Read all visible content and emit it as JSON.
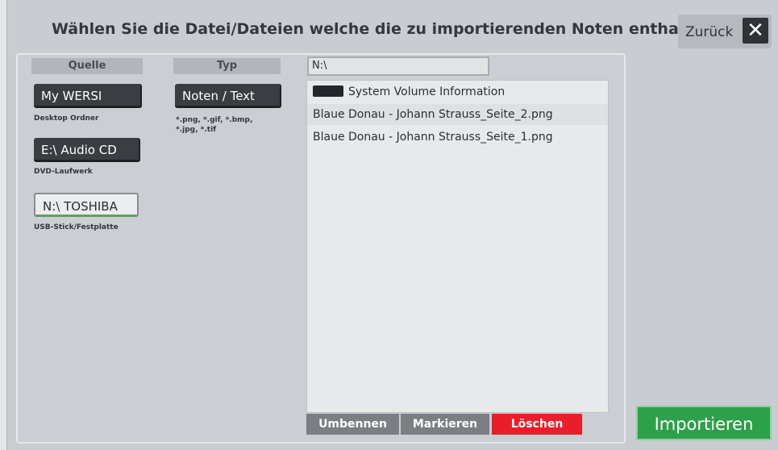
{
  "dialog": {
    "title": "Wählen Sie die Datei/Dateien welche die zu importierenden Noten enthalten.",
    "back_label": "Zurück",
    "close_glyph": "✕"
  },
  "source": {
    "header": "Quelle",
    "items": [
      {
        "label": "My WERSI",
        "sub": "Desktop Ordner"
      },
      {
        "label": "E:\\ Audio CD",
        "sub": "DVD-Laufwerk"
      },
      {
        "label": "N:\\ TOSHIBA",
        "sub": "USB-Stick/Festplatte"
      }
    ]
  },
  "type": {
    "header": "Typ",
    "button_label": "Noten / Text",
    "formats_line1": "*.png, *.gif, *.bmp,",
    "formats_line2": "*.jpg, *.tif"
  },
  "browser": {
    "path": "N:\\",
    "entries": [
      {
        "name": "System Volume Information",
        "kind": "folder"
      },
      {
        "name": "Blaue Donau - Johann Strauss_Seite_2.png",
        "kind": "file"
      },
      {
        "name": "Blaue Donau - Johann Strauss_Seite_1.png",
        "kind": "file"
      }
    ]
  },
  "actions": {
    "rename": "Umbennen",
    "mark": "Markieren",
    "delete": "Löschen",
    "import": "Importieren"
  },
  "colors": {
    "delete_red": "#ea1e2b",
    "import_green": "#2da14a",
    "gray_button": "#7b7e83"
  }
}
